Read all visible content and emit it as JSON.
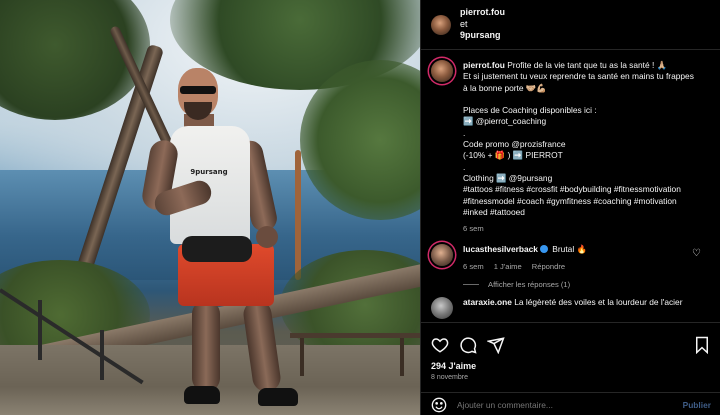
{
  "header": {
    "author": "pierrot.fou",
    "conjunction": "et",
    "collaborator": "9pursang"
  },
  "photo": {
    "tank_logo_text": "9pursang"
  },
  "caption": {
    "username": "pierrot.fou",
    "lines": [
      "Profite de la vie tant que tu as la santé ! 🙏🏼",
      "Et si justement tu veux reprendre ta santé en mains tu frappes",
      "à la bonne porte 🤝🏼💪🏼",
      "",
      "Places de Coaching disponibles ici :",
      "➡️ @pierrot_coaching",
      ".",
      "Code promo @prozisfrance",
      "(-10% + 🎁 ) ➡️ PIERROT",
      ".",
      "Clothing ➡️ @9pursang",
      "#tattoos #fitness #crossfit #bodybuilding #fitnessmotivation",
      "#fitnessmodel #coach #gymfitness #coaching #motivation",
      "#inked #tattooed"
    ],
    "age": "6 sem"
  },
  "comments": [
    {
      "username": "lucasthesilverback",
      "verified": true,
      "text": "Brutal 🔥",
      "age": "6 sem",
      "likes": "1 J'aime",
      "reply": "Répondre",
      "heart": "♡",
      "view_replies": "Afficher les réponses (1)"
    },
    {
      "username": "ataraxie.one",
      "text": "La légèreté des voiles et la lourdeur de l'acier"
    }
  ],
  "footer": {
    "likes": "294 J'aime",
    "date": "8 novembre",
    "comment_placeholder": "Ajouter un commentaire...",
    "publish_label": "Publier"
  },
  "icons": {
    "like": "heart-icon",
    "comment": "comment-icon",
    "share": "share-icon",
    "save": "bookmark-icon",
    "emoji": "emoji-icon"
  },
  "colors": {
    "background": "#000000",
    "text": "#f5f5f5",
    "muted": "#a8a8a8",
    "divider": "#262626",
    "verified": "#3897f0",
    "publish": "#3f5d87",
    "story_ring": "#d22a68"
  }
}
